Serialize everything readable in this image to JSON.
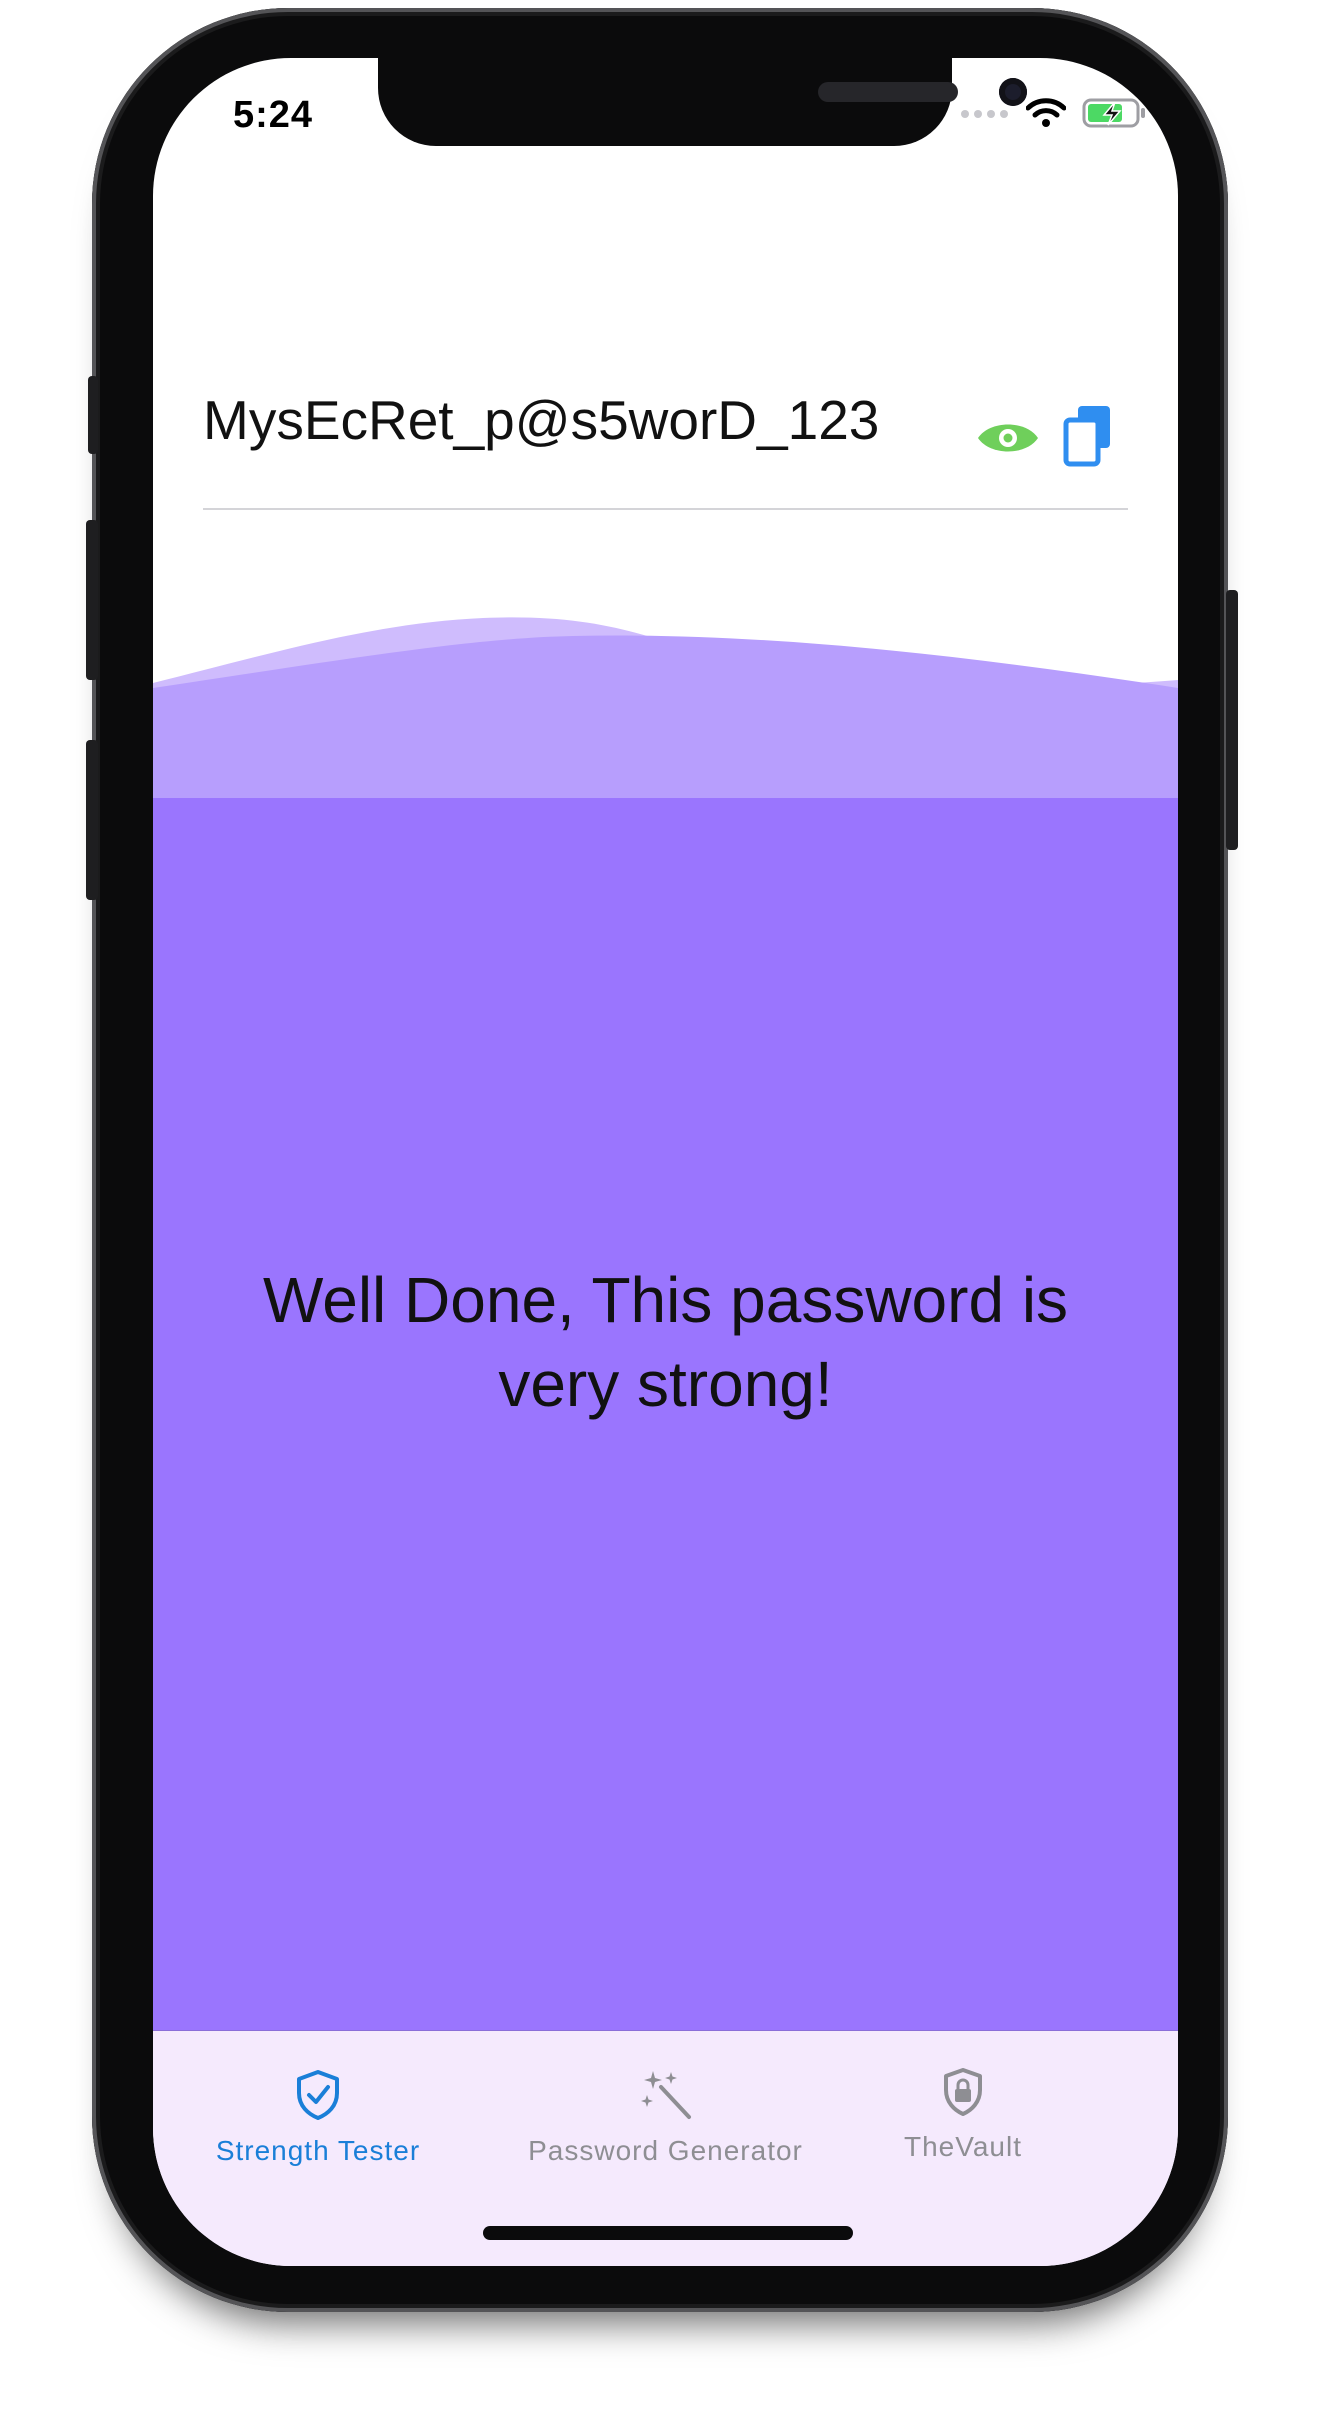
{
  "status_bar": {
    "time": "5:24",
    "icons": [
      "cellular-signal-icon",
      "wifi-icon",
      "battery-charging-icon"
    ]
  },
  "password_field": {
    "value": "MysEcRet_p@s5worD_123",
    "show_icon": "eye-icon",
    "copy_icon": "copy-icon"
  },
  "strength": {
    "message": "Well Done, This password is very strong!",
    "colors": {
      "fill": "#9a75fe",
      "wave_light": "#cfbcfd",
      "wave_mid": "#b79efd",
      "tab_bar_bg": "#f5eafd"
    }
  },
  "tab_bar": {
    "tabs": [
      {
        "label": "Strength Tester",
        "icon": "shield-check-icon",
        "active": true,
        "color": "#1a7fd8"
      },
      {
        "label": "Password Generator",
        "icon": "magic-wand-icon",
        "active": false,
        "color": "#8e8e93"
      },
      {
        "label": "TheVault",
        "icon": "lock-shield-icon",
        "active": false,
        "color": "#8e8e93"
      }
    ]
  },
  "colors": {
    "eye_icon": "#6fcf5b",
    "copy_icon": "#2f8ef0",
    "battery": "#4cd964"
  }
}
